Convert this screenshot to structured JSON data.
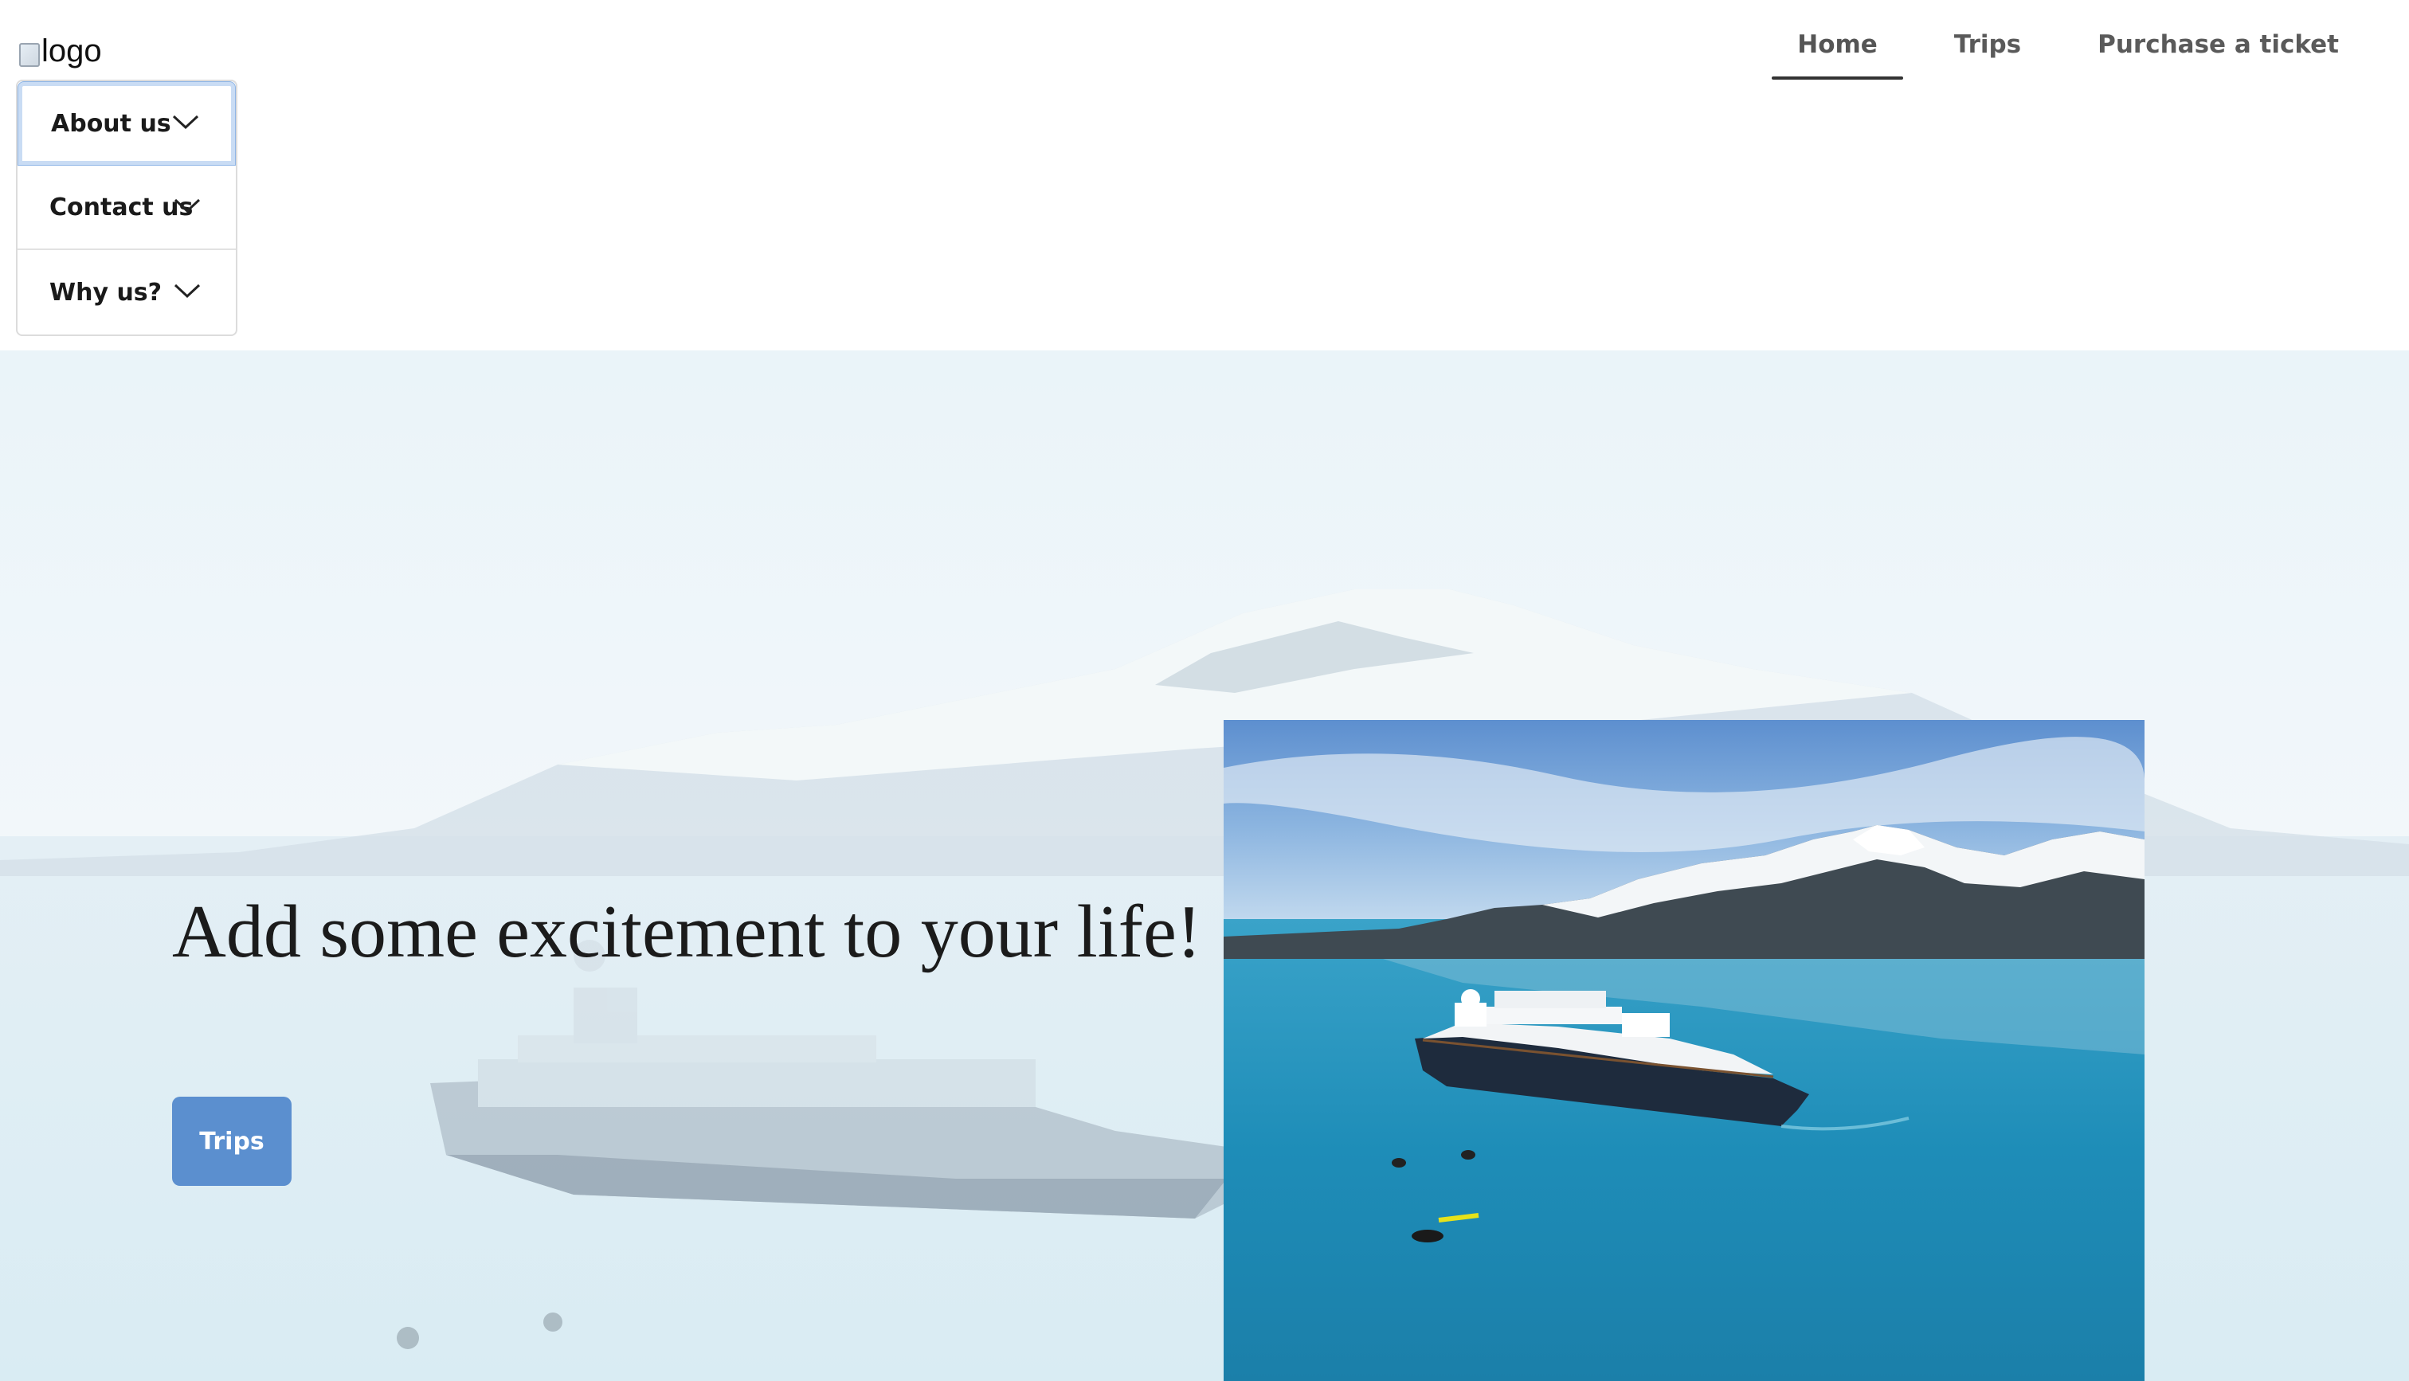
{
  "header": {
    "logo_alt": "logo",
    "accordion": [
      {
        "label": "About us",
        "active": true
      },
      {
        "label": "Contact us",
        "active": false
      },
      {
        "label": "Why us?",
        "active": false
      }
    ],
    "nav": [
      {
        "label": "Home",
        "current": true
      },
      {
        "label": "Trips",
        "current": false
      },
      {
        "label": "Purchase a ticket",
        "current": false
      }
    ]
  },
  "hero": {
    "headline": "Add some excitement to your life!",
    "cta_label": "Trips",
    "cta_color": "#5b8fcf"
  }
}
